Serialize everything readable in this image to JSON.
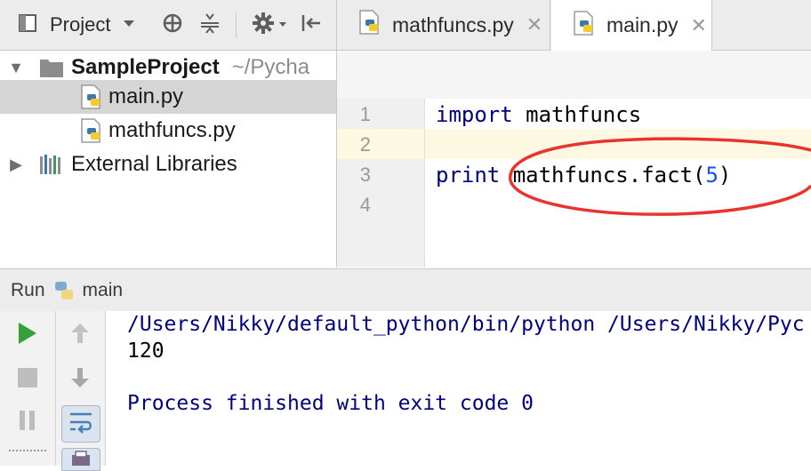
{
  "toolbar": {
    "project_label": "Project"
  },
  "tabs": [
    {
      "label": "mathfuncs.py",
      "active": false
    },
    {
      "label": "main.py",
      "active": true
    }
  ],
  "tree": {
    "root_name": "SampleProject",
    "root_path": "~/Pycha",
    "files": [
      "main.py",
      "mathfuncs.py"
    ],
    "external": "External Libraries"
  },
  "editor": {
    "line_numbers": [
      "1",
      "2",
      "3",
      "4"
    ],
    "line1_kw": "import",
    "line1_rest": " mathfuncs",
    "line3_kw": "print",
    "line3_rest": " mathfuncs.fact(",
    "line3_num": "5",
    "line3_close": ")"
  },
  "run": {
    "label": "Run",
    "config": "main"
  },
  "console": {
    "line1": "/Users/Nikky/default_python/bin/python /Users/Nikky/Pyc",
    "line2": "120",
    "line3": "Process finished with exit code 0"
  },
  "colors": {
    "keyword": "#000080",
    "number": "#1750eb",
    "annotation": "#e8332f",
    "run_green": "#36a13a"
  }
}
